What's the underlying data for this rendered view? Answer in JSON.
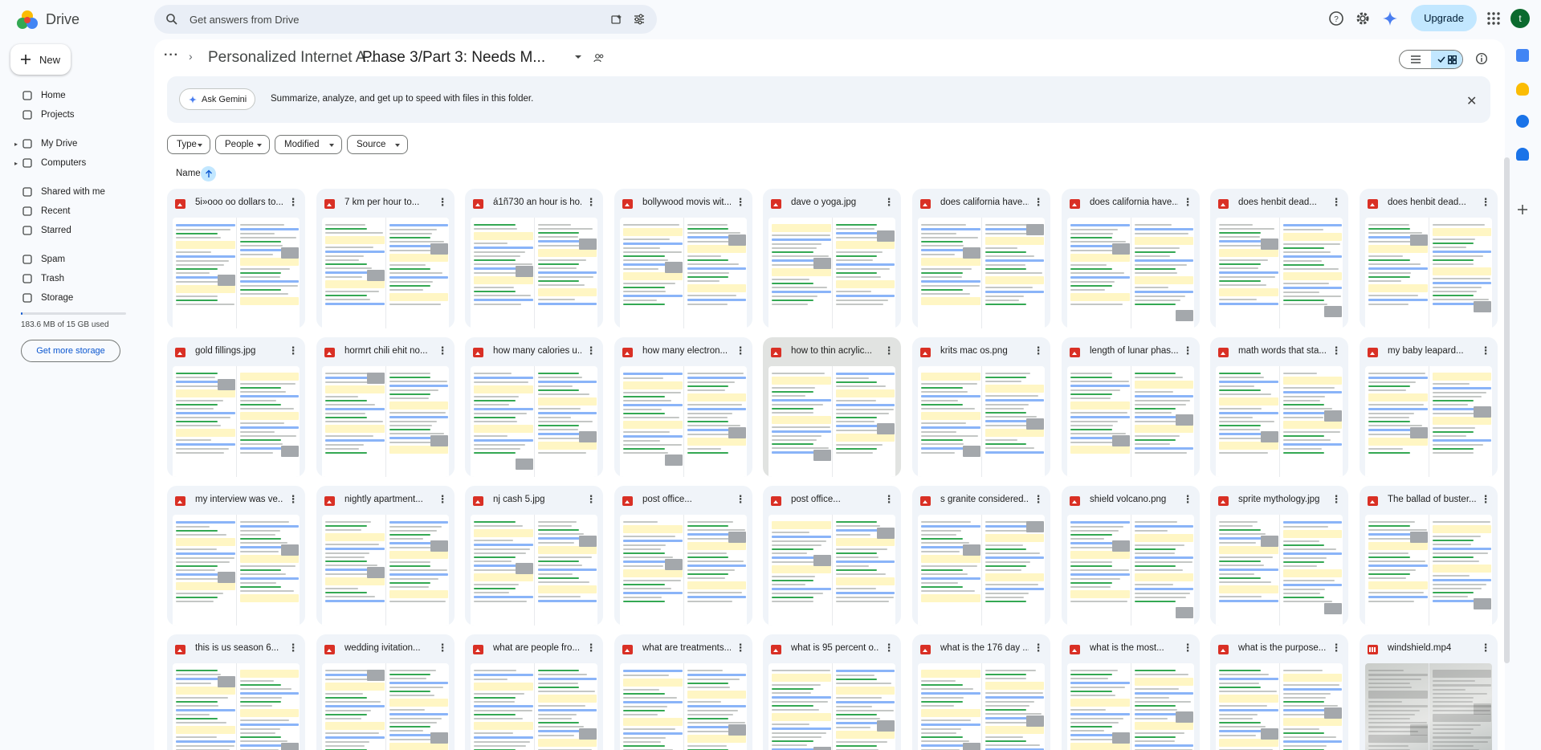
{
  "app": {
    "name": "Drive"
  },
  "search": {
    "placeholder": "Get answers from Drive"
  },
  "header": {
    "upgrade_label": "Upgrade",
    "avatar_initial": "t"
  },
  "sidebar": {
    "new_label": "New",
    "items": [
      {
        "label": "Home",
        "icon": "home-icon"
      },
      {
        "label": "Projects",
        "icon": "projects-icon"
      },
      {
        "label": "My Drive",
        "icon": "my-drive-icon"
      },
      {
        "label": "Computers",
        "icon": "computers-icon"
      },
      {
        "label": "Shared with me",
        "icon": "shared-icon"
      },
      {
        "label": "Recent",
        "icon": "recent-icon"
      },
      {
        "label": "Starred",
        "icon": "star-icon"
      },
      {
        "label": "Spam",
        "icon": "spam-icon"
      },
      {
        "label": "Trash",
        "icon": "trash-icon"
      },
      {
        "label": "Storage",
        "icon": "cloud-icon"
      }
    ],
    "storage_used": "183.6 MB of 15 GB used",
    "storage_fraction": 0.012,
    "get_more_storage": "Get more storage"
  },
  "breadcrumb": {
    "parent": "Personalized Internet A...",
    "current": "Phase 3/Part 3: Needs M..."
  },
  "gemini": {
    "button_label": "Ask Gemini",
    "prompt": "Summarize, analyze, and get up to speed with files in this folder."
  },
  "filters": [
    "Type",
    "People",
    "Modified",
    "Source"
  ],
  "sort": {
    "label": "Name"
  },
  "files": [
    {
      "name": "5i»ooo oo dollars to...",
      "type": "image"
    },
    {
      "name": "7 km per hour to...",
      "type": "image"
    },
    {
      "name": "á1ñ730 an hour is ho...",
      "type": "image"
    },
    {
      "name": "bollywood movis wit...",
      "type": "image"
    },
    {
      "name": "dave o yoga.jpg",
      "type": "image"
    },
    {
      "name": "does california have...",
      "type": "image"
    },
    {
      "name": "does california have...",
      "type": "image"
    },
    {
      "name": "does henbit dead...",
      "type": "image"
    },
    {
      "name": "does henbit dead...",
      "type": "image"
    },
    {
      "name": "gold fillings.jpg",
      "type": "image"
    },
    {
      "name": "hormrt chili ehit no...",
      "type": "image"
    },
    {
      "name": "how many calories u...",
      "type": "image"
    },
    {
      "name": "how many electron...",
      "type": "image"
    },
    {
      "name": "how to thin acrylic...",
      "type": "image"
    },
    {
      "name": "krits mac os.png",
      "type": "image"
    },
    {
      "name": "length of lunar phas...",
      "type": "image"
    },
    {
      "name": "math words that sta...",
      "type": "image"
    },
    {
      "name": "my baby leapard...",
      "type": "image"
    },
    {
      "name": "my interview was ve...",
      "type": "image"
    },
    {
      "name": "nightly apartment...",
      "type": "image"
    },
    {
      "name": "nj cash 5.jpg",
      "type": "image"
    },
    {
      "name": "post office...",
      "type": "image"
    },
    {
      "name": "post office...",
      "type": "image"
    },
    {
      "name": "s granite considered...",
      "type": "image"
    },
    {
      "name": "shield volcano.png",
      "type": "image"
    },
    {
      "name": "sprite mythology.jpg",
      "type": "image"
    },
    {
      "name": "The ballad of buster...",
      "type": "image"
    },
    {
      "name": "this is us season 6...",
      "type": "image"
    },
    {
      "name": "wedding ivitation...",
      "type": "image"
    },
    {
      "name": "what are people fro...",
      "type": "image"
    },
    {
      "name": "what are treatments...",
      "type": "image"
    },
    {
      "name": "what is 95 percent o...",
      "type": "image"
    },
    {
      "name": "what is the 176 day ...",
      "type": "image"
    },
    {
      "name": "what is the most...",
      "type": "image"
    },
    {
      "name": "what is the purpose...",
      "type": "image"
    },
    {
      "name": "windshield.mp4",
      "type": "video"
    }
  ],
  "colors": {
    "accent": "#0b57d0",
    "selected_chip": "#c2e7ff",
    "card_bg": "#f0f4f9",
    "file_icon_red": "#d93025"
  }
}
